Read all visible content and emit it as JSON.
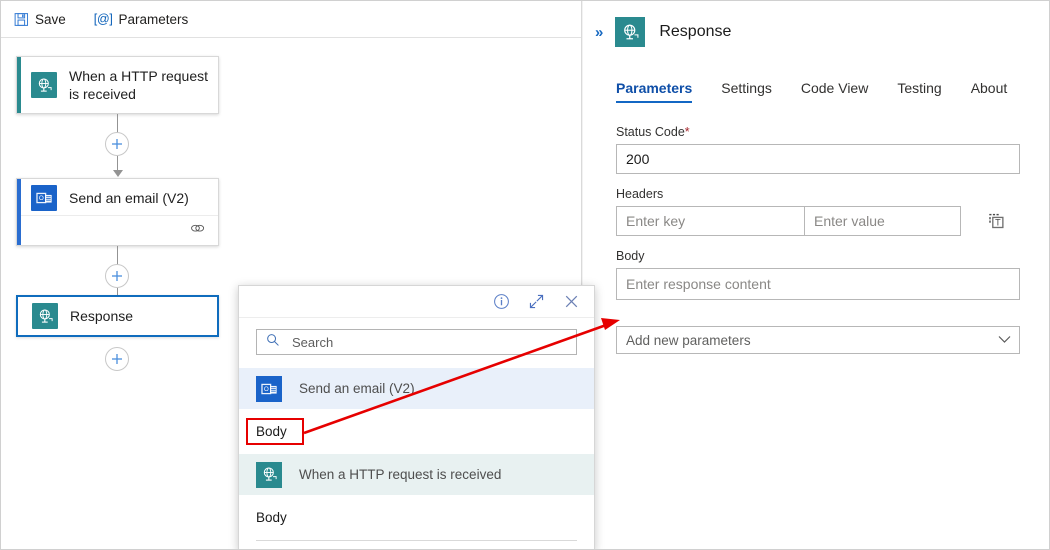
{
  "toolbar": {
    "save_label": "Save",
    "save_icon": "save-floppy-icon",
    "parameters_label": "Parameters",
    "parameters_icon": "at-bracket-icon"
  },
  "canvas": {
    "nodes": [
      {
        "title": "When a HTTP request is received",
        "icon": "http-request-icon",
        "icon_color": "#2a8a8f",
        "accent_color": "#2a8a8f",
        "selected": false
      },
      {
        "title": "Send an email (V2)",
        "icon": "outlook-email-icon",
        "icon_color": "#1a63c9",
        "accent_color": "#2a6dd0",
        "selected": false,
        "footer_icon": "connection-link-icon"
      },
      {
        "title": "Response",
        "icon": "response-globe-icon",
        "icon_color": "#2a8a8f",
        "accent_color": "#0f6cbd",
        "selected": true
      }
    ],
    "add_button_label": "+",
    "add_button_icon": "plus-icon"
  },
  "right_panel": {
    "collapse_icon": "double-chevron-right-icon",
    "node_icon": "response-globe-icon",
    "title": "Response",
    "tabs": [
      {
        "label": "Parameters",
        "active": true
      },
      {
        "label": "Settings",
        "active": false
      },
      {
        "label": "Code View",
        "active": false
      },
      {
        "label": "Testing",
        "active": false
      },
      {
        "label": "About",
        "active": false
      }
    ],
    "fields": {
      "status_code": {
        "label": "Status Code",
        "required": true,
        "required_marker": "*",
        "value": "200"
      },
      "headers": {
        "label": "Headers",
        "key_placeholder": "Enter key",
        "key_value": "",
        "value_placeholder": "Enter value",
        "value_value": "",
        "tool_icon": "switch-to-text-mode-icon"
      },
      "body": {
        "label": "Body",
        "placeholder": "Enter response content",
        "value": ""
      },
      "add_parameters": {
        "selected": "Add new parameters",
        "chevron_icon": "chevron-down-icon"
      }
    },
    "accent_color": "#1367c4"
  },
  "dynamic_content_popup": {
    "header_icons": [
      {
        "name": "info-icon",
        "glyph": "i"
      },
      {
        "name": "expand-diagonal-icon",
        "glyph": "arrow"
      },
      {
        "name": "close-icon",
        "glyph": "x"
      }
    ],
    "search": {
      "placeholder": "Search",
      "value": "",
      "icon": "search-icon"
    },
    "groups": [
      {
        "label": "Send an email (V2)",
        "icon": "outlook-email-icon",
        "icon_color": "#1a63c9",
        "row_bg": "#e9f0fa",
        "items": [
          {
            "label": "Body",
            "highlighted": true
          }
        ]
      },
      {
        "label": "When a HTTP request is received",
        "icon": "http-request-icon",
        "icon_color": "#2a8a8f",
        "row_bg": "#e8f1f1",
        "items": [
          {
            "label": "Body",
            "highlighted": false
          }
        ]
      }
    ]
  },
  "annotation": {
    "highlight_color": "#e60000",
    "arrow_from": "dynamic-content-body-token",
    "arrow_to": "response-body-input"
  }
}
